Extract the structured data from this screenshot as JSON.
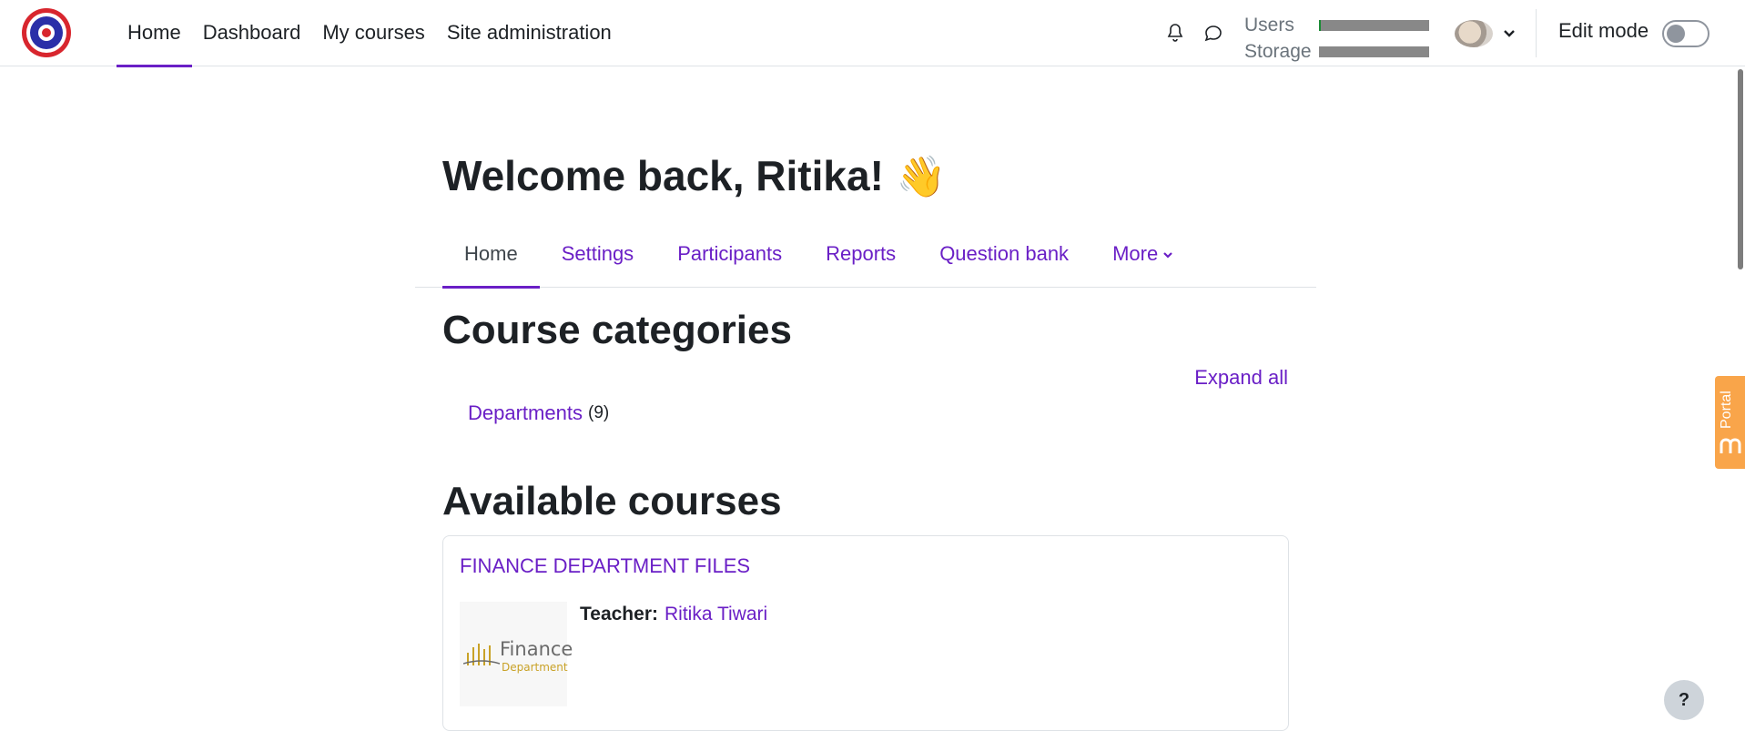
{
  "navbar": {
    "items": [
      {
        "label": "Home",
        "active": true
      },
      {
        "label": "Dashboard",
        "active": false
      },
      {
        "label": "My courses",
        "active": false
      },
      {
        "label": "Site administration",
        "active": false
      }
    ],
    "quota": {
      "users_label": "Users",
      "storage_label": "Storage",
      "users_fill_percent": 2,
      "storage_fill_percent": 0,
      "fill_color": "#1a8a34",
      "bar_color": "#888888"
    },
    "icons": [
      "bell-icon",
      "chat-bubble-icon",
      "chevron-down-icon"
    ],
    "edit_mode_label": "Edit mode",
    "edit_mode_on": false
  },
  "page": {
    "title": "Welcome back, Ritika!",
    "title_emoji": "👋"
  },
  "secondary_nav": {
    "tabs": [
      {
        "label": "Home",
        "active": true
      },
      {
        "label": "Settings",
        "active": false
      },
      {
        "label": "Participants",
        "active": false
      },
      {
        "label": "Reports",
        "active": false
      },
      {
        "label": "Question bank",
        "active": false
      },
      {
        "label": "More",
        "active": false
      }
    ]
  },
  "categories": {
    "heading": "Course categories",
    "expand_all": "Expand all",
    "items": [
      {
        "name": "Departments",
        "count": "(9)"
      }
    ]
  },
  "courses": {
    "heading": "Available courses",
    "items": [
      {
        "name": "FINANCE DEPARTMENT FILES",
        "image_text_main": "Finance",
        "image_text_sub": "Department",
        "teacher_label": "Teacher:",
        "teacher_name": "Ritika Tiwari"
      }
    ]
  },
  "widgets": {
    "portal_label": "Portal",
    "help_label": "?"
  },
  "colors": {
    "accent": "#6a1fc6",
    "portal": "#f9a54a"
  }
}
